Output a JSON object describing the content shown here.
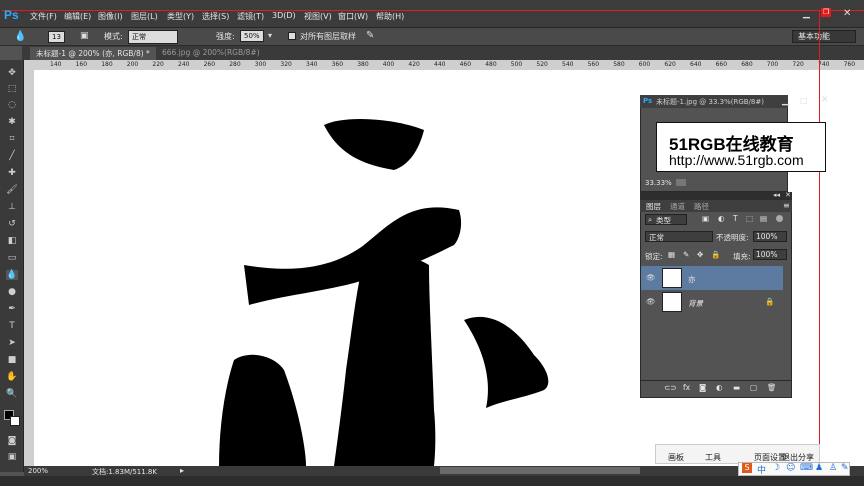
{
  "app": {
    "logo": "Ps"
  },
  "menu": [
    "文件(F)",
    "编辑(E)",
    "图像(I)",
    "图层(L)",
    "类型(Y)",
    "选择(S)",
    "滤镜(T)",
    "3D(D)",
    "视图(V)",
    "窗口(W)",
    "帮助(H)"
  ],
  "options": {
    "brush_size": "13",
    "mode_label": "模式:",
    "mode_value": "正常",
    "strength_label": "强度:",
    "strength_value": "50%",
    "sample_all_label": "对所有图层取样",
    "workspace": "基本功能"
  },
  "tabs": [
    {
      "label": "未标题-1 @ 200% (亦, RGB/8) *",
      "active": true
    },
    {
      "label": "666.jpg @ 200%(RGB/8#)",
      "active": false
    }
  ],
  "ruler": {
    "top_ticks": [
      "140",
      "160",
      "180",
      "200",
      "220",
      "240",
      "260",
      "280",
      "300",
      "320",
      "340",
      "360",
      "380",
      "400",
      "420",
      "440",
      "460",
      "480",
      "500",
      "520",
      "540",
      "560",
      "580",
      "600",
      "620",
      "640",
      "660",
      "680",
      "700",
      "720",
      "740",
      "760"
    ]
  },
  "status": {
    "zoom": "200%",
    "doc_info": "文档:1.83M/511.8K"
  },
  "navigator": {
    "title": "未标题-1.jpg @ 33.3%(RGB/8#)",
    "preview_line1": "51RGB在线教育",
    "preview_line2": "http://www.51rgb.com",
    "zoom": "33.33%"
  },
  "layers": {
    "tabs": [
      "图层",
      "通道",
      "路径"
    ],
    "filter_kind": "类型",
    "blend_mode": "正常",
    "opacity_label": "不透明度:",
    "opacity_value": "100%",
    "lock_label": "锁定:",
    "fill_label": "填充:",
    "fill_value": "100%",
    "items": [
      {
        "name": "亦",
        "selected": true
      },
      {
        "name": "背景",
        "selected": false
      }
    ]
  },
  "web_toolbar": {
    "items": [
      "画板",
      "工具",
      "页面设置",
      "退出分享"
    ]
  },
  "ime": {
    "label": "中"
  },
  "colors": {
    "accent": "#31a8ff",
    "guide": "#e01c1c",
    "selected_layer": "#5d7aa0"
  }
}
